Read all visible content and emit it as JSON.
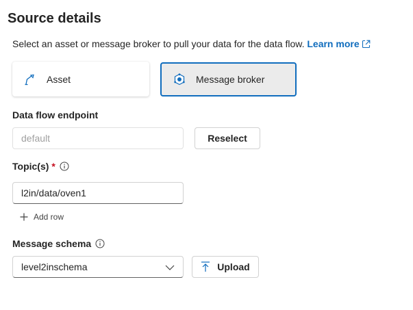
{
  "header": {
    "title": "Source details",
    "description": "Select an asset or message broker to pull your data for the data flow.",
    "learn_more": "Learn more"
  },
  "source_type": {
    "options": [
      {
        "label": "Asset",
        "icon": "asset-icon",
        "selected": false
      },
      {
        "label": "Message broker",
        "icon": "message-broker-icon",
        "selected": true
      }
    ]
  },
  "endpoint": {
    "label": "Data flow endpoint",
    "placeholder": "default",
    "reselect_label": "Reselect"
  },
  "topics": {
    "label": "Topic(s)",
    "required_mark": "*",
    "values": [
      "l2in/data/oven1"
    ],
    "add_row_label": "Add row"
  },
  "schema": {
    "label": "Message schema",
    "selected": "level2inschema",
    "upload_label": "Upload"
  },
  "colors": {
    "accent": "#0f6cbd",
    "required": "#c50f1f",
    "selected_bg": "#ebebeb"
  }
}
